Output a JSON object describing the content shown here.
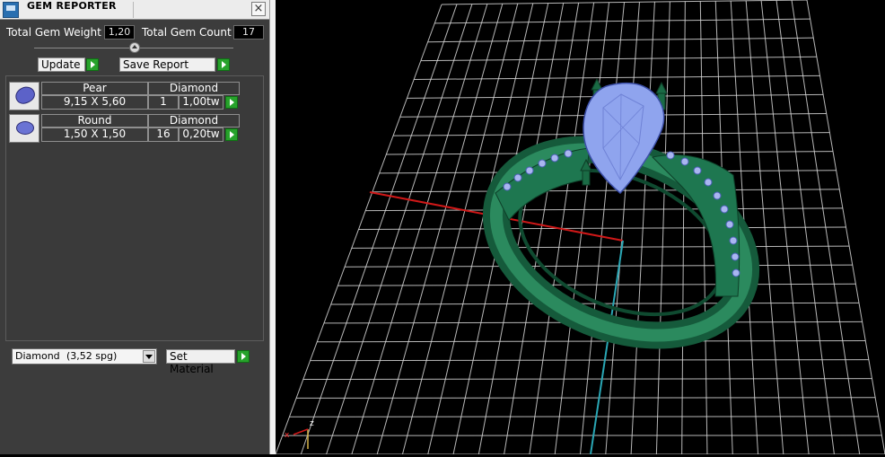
{
  "panel": {
    "title": "GEM REPORTER",
    "close_label": "×",
    "total_gem_weight_label": "Total Gem Weight",
    "total_gem_weight_value": "1,20",
    "total_gem_count_label": "Total Gem Count",
    "total_gem_count_value": "17",
    "update_label": "Update",
    "save_report_label": "Save Report",
    "gems": [
      {
        "shape": "Pear",
        "size": "9,15 X 5,60",
        "material": "Diamond",
        "count": "1",
        "weight": "1,00tw",
        "icon": "pear-gem-icon"
      },
      {
        "shape": "Round",
        "size": "1,50 X 1,50",
        "material": "Diamond",
        "count": "16",
        "weight": "0,20tw",
        "icon": "round-gem-icon"
      }
    ],
    "material_select": {
      "name": "Diamond",
      "spec": "(3,52 spg)"
    },
    "set_material_label": "Set Material"
  },
  "viewport": {
    "axis_x_label": "x",
    "axis_z_label": "z",
    "colors": {
      "grid": "#d8d8d8",
      "x_axis": "#d01818",
      "y_axis": "#2aa7b5",
      "ring": "#1f6b4a",
      "gem": "#8fa4ee"
    }
  }
}
